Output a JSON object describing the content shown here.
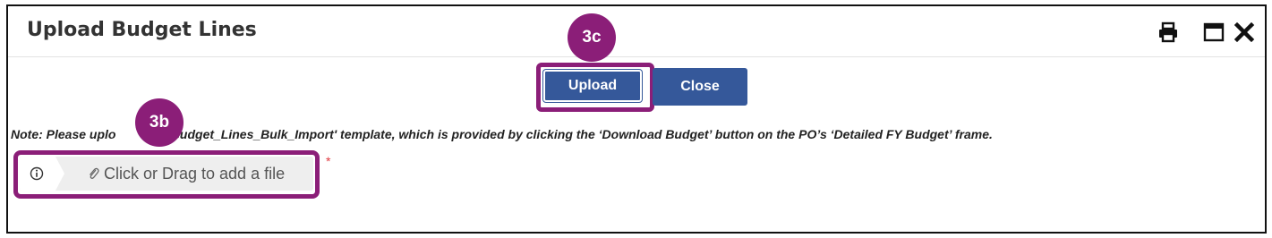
{
  "dialog": {
    "title": "Upload Budget Lines",
    "header_icons": [
      "printer-icon",
      "maximize-icon",
      "close-icon"
    ]
  },
  "buttons": {
    "upload_label": "Upload",
    "close_label": "Close"
  },
  "annotations": {
    "badge_3c": "3c",
    "badge_3b": "3b"
  },
  "note": {
    "part1": "Note: Please uplo",
    "part2": "'Budget_Lines_Bulk_Import' template, which is provided by clicking the ‘Download Budget’ button on the PO’s ‘Detailed FY Budget’ frame."
  },
  "file_upload": {
    "label": "Click or Drag to add a file",
    "required_marker": "*"
  },
  "colors": {
    "button": "#35589a",
    "annotation": "#8b1e78",
    "required": "#e0383e"
  }
}
